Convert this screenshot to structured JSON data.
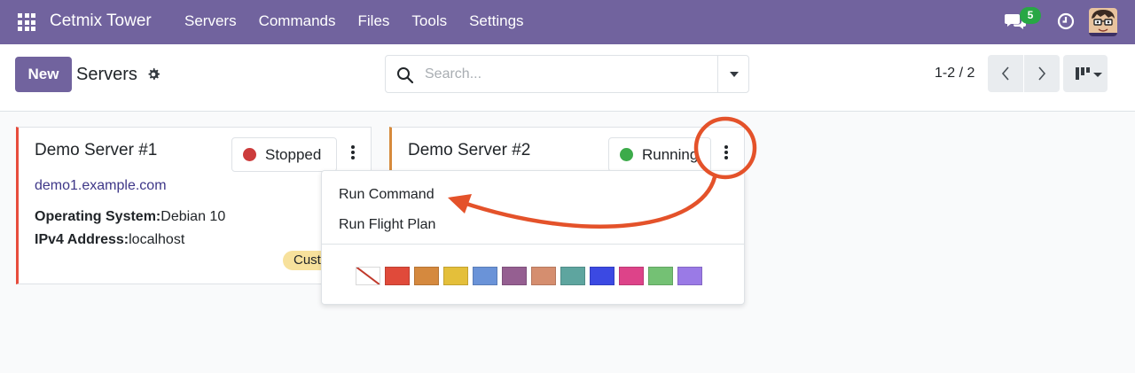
{
  "navbar": {
    "brand": "Cetmix Tower",
    "menu": [
      "Servers",
      "Commands",
      "Files",
      "Tools",
      "Settings"
    ],
    "chat_count": "5",
    "color": "#71639e"
  },
  "control": {
    "new_label": "New",
    "title": "Servers",
    "search_placeholder": "Search...",
    "pager": "1-2 / 2"
  },
  "cards": [
    {
      "title": "Demo Server #1",
      "status": "Stopped",
      "status_color": "#cc3b3b",
      "url": "demo1.example.com",
      "os_label": "Operating System:",
      "os_value": "Debian 10",
      "ip_label": "IPv4 Address:",
      "ip_value": "localhost",
      "tag": "Customer"
    },
    {
      "title": "Demo Server #2",
      "status": "Running",
      "status_color": "#3cab4a"
    }
  ],
  "dropdown": {
    "items": [
      "Run Command",
      "Run Flight Plan"
    ],
    "colors": [
      "none",
      "#e04a3a",
      "#d5893e",
      "#e4bf3a",
      "#6a93d8",
      "#955f91",
      "#d58e6f",
      "#5ea59f",
      "#3b49e3",
      "#dd4389",
      "#74c174",
      "#9a7ae6"
    ]
  },
  "annotation": {
    "color": "#e4522a"
  }
}
